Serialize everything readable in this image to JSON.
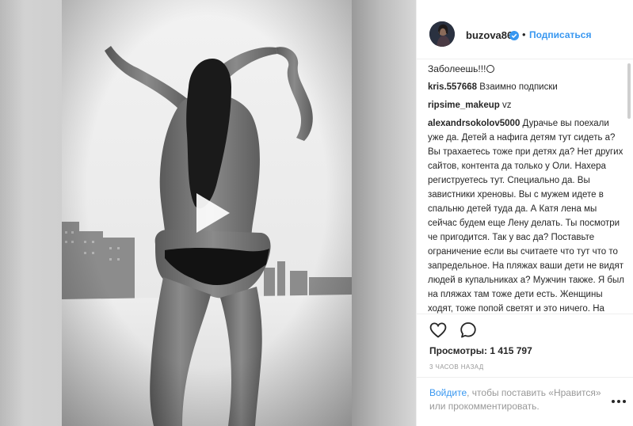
{
  "post": {
    "username": "buzova86",
    "follow_label": "Подписаться",
    "separator": "•",
    "caption_tail": "Заболеешь!!!",
    "comments": [
      {
        "user": "kris.557668",
        "text": "Взаимно подписки"
      },
      {
        "user": "ripsime_makeup",
        "text": "vz"
      },
      {
        "user": "alexandrsokolov5000",
        "text": "Дурачье вы поехали уже да. Детей а нафига детям тут сидеть а? Вы трахаетесь тоже при детях да? Нет других сайтов, контента да только у Оли. Нахера региструетесь тут. Специально да. Вы завистники хреновы. Вы с мужем идете в спальню детей туда да. А Катя лена мы сейчас будем еще Лену делать. Ты посмотри че пригодится. Так у вас да? Поставьте ограничение если вы считаете что тут что то запредельное. На пляжах ваши дети не видят людей в купальниках а? Мужчин также. Я был на пляжах там тоже дети есть. Женщины ходят, тоже попой светят и это ничего. На улице девушки ходят,"
      }
    ],
    "views_label": "Просмотры:",
    "views_value": "1 415 797",
    "timestamp": "3 часов назад",
    "login_link": "Войдите",
    "login_rest": ", чтобы поставить «Нравится» или прокомментировать."
  },
  "icons": {
    "play": "play-icon",
    "like": "heart-icon",
    "comment": "comment-icon",
    "verified": "verified-badge-icon",
    "more": "more-options-icon"
  },
  "colors": {
    "link": "#3897f0",
    "text": "#262626",
    "muted": "#999999",
    "border": "#efefef"
  }
}
